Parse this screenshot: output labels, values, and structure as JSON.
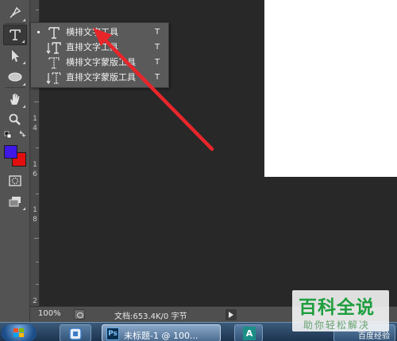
{
  "colors": {
    "foreground_swatch": "#3f17e6",
    "background_swatch": "#e30f0f",
    "annotation_arrow": "#e8262a"
  },
  "toolbar": {
    "tools": [
      {
        "name": "pen-icon"
      },
      {
        "name": "type-tool-icon",
        "label": "T",
        "active": true
      },
      {
        "name": "path-selection-icon"
      },
      {
        "name": "ellipse-icon"
      },
      {
        "name": "hand-icon"
      },
      {
        "name": "zoom-icon"
      },
      {
        "name": "quick-mask-icon"
      },
      {
        "name": "screen-mode-icon"
      }
    ]
  },
  "ruler": {
    "numbers": [
      "1",
      "2",
      "1",
      "4",
      "1",
      "6",
      "1",
      "8",
      "2"
    ]
  },
  "flyout": {
    "items": [
      {
        "label": "横排文字工具",
        "shortcut": "T",
        "icon": "horizontal-type-icon",
        "selected": true
      },
      {
        "label": "直排文字工具",
        "shortcut": "T",
        "icon": "vertical-type-icon",
        "selected": false
      },
      {
        "label": "横排文字蒙版工具",
        "shortcut": "T",
        "icon": "horizontal-type-mask-icon",
        "selected": false
      },
      {
        "label": "直排文字蒙版工具",
        "shortcut": "T",
        "icon": "vertical-type-mask-icon",
        "selected": false
      }
    ]
  },
  "statusbar": {
    "zoom": "100%",
    "doc_info": "文档:653.4K/0 字节"
  },
  "taskbar": {
    "ps_icon": "Ps",
    "ps_title": "未标题-1 @ 100...",
    "a_icon": "A",
    "baidu_text": "百度经验"
  },
  "watermark": {
    "title": "百科全说",
    "subtitle": "助你轻松解决"
  }
}
